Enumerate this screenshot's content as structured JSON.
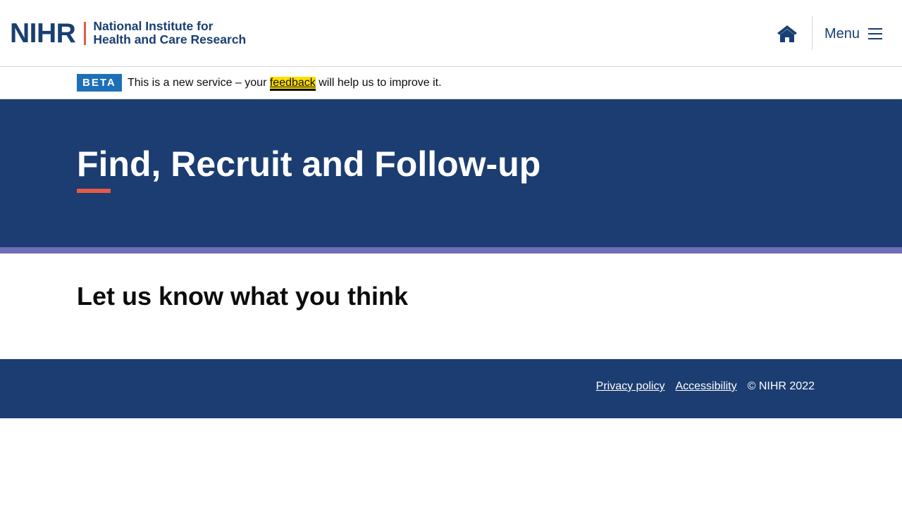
{
  "header": {
    "logo_mark": "NIHR",
    "logo_line1": "National Institute for",
    "logo_line2": "Health and Care Research",
    "home_icon": "home-icon",
    "menu_label": "Menu",
    "menu_icon": "hamburger-icon"
  },
  "beta_banner": {
    "tag": "BETA",
    "text_before": "This is a new service – your ",
    "link_text": "feedback",
    "text_after": " will help us to improve it."
  },
  "hero": {
    "title": "Find, Recruit and Follow-up"
  },
  "main": {
    "heading": "Let us know what you think"
  },
  "footer": {
    "links": [
      "Privacy policy",
      "Accessibility"
    ],
    "copyright": "© NIHR 2022"
  },
  "colors": {
    "brand_navy": "#1b3d71",
    "accent_coral": "#e65a46",
    "stripe_purple": "#6f6db5",
    "beta_blue": "#1d70b8",
    "focus_yellow": "#ffdd00"
  }
}
